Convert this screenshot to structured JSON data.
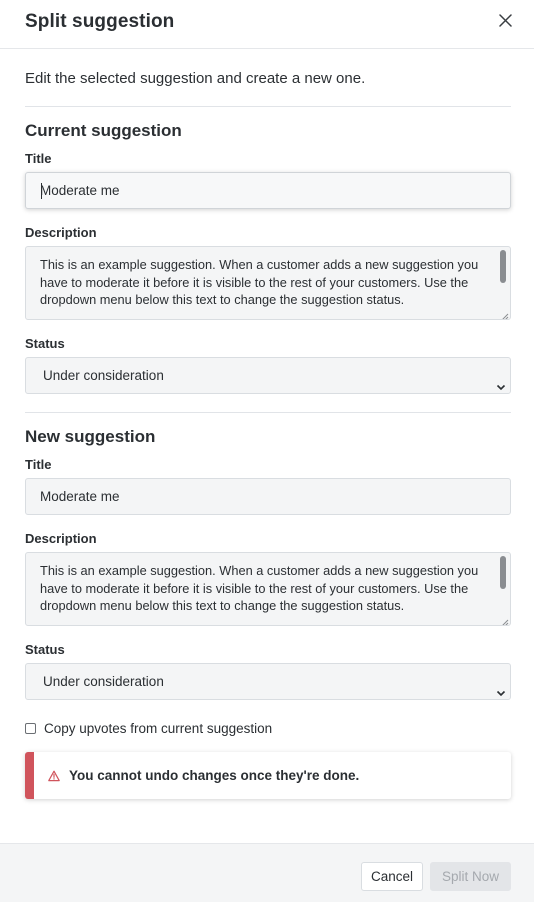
{
  "dialog": {
    "title": "Split suggestion",
    "intro": "Edit the selected suggestion and create a new one."
  },
  "current": {
    "heading": "Current suggestion",
    "title_label": "Title",
    "title_value": "Moderate me",
    "description_label": "Description",
    "description_value": "This is an example suggestion. When a customer adds a new suggestion you have to moderate it before it is visible to the rest of your customers. Use the dropdown menu below this text to change the suggestion status.",
    "status_label": "Status",
    "status_value": "Under consideration"
  },
  "new": {
    "heading": "New suggestion",
    "title_label": "Title",
    "title_value": "Moderate me",
    "description_label": "Description",
    "description_value": "This is an example suggestion. When a customer adds a new suggestion you have to moderate it before it is visible to the rest of your customers. Use the dropdown menu below this text to change the suggestion status.",
    "status_label": "Status",
    "status_value": "Under consideration"
  },
  "copy_upvotes_label": "Copy upvotes from current suggestion",
  "warning": {
    "text": "You cannot undo changes once they're done.",
    "color": "#d0545c",
    "icon": "warning-triangle-icon"
  },
  "footer": {
    "cancel_label": "Cancel",
    "split_label": "Split Now"
  },
  "icons": {
    "close": "close-icon",
    "chevron": "chevron-down-icon"
  }
}
